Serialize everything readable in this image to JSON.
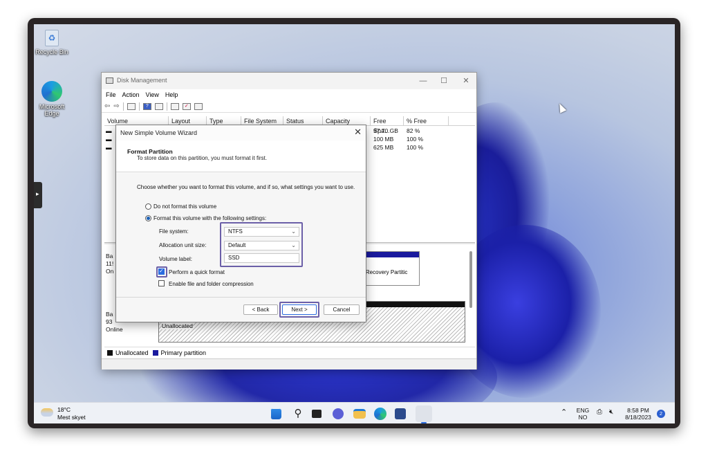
{
  "desktop": {
    "icons": [
      {
        "label": "Recycle Bin",
        "icon": "recycle-bin-icon"
      },
      {
        "label": "Microsoft Edge",
        "icon": "edge-icon"
      }
    ]
  },
  "disk_management": {
    "title": "Disk Management",
    "menu": [
      "File",
      "Action",
      "View",
      "Help"
    ],
    "columns": [
      "Volume",
      "Layout",
      "Type",
      "File System",
      "Status",
      "Capacity",
      "Free Spa...",
      "% Free"
    ],
    "rows": [
      {
        "volume": "",
        "free": "97.70 GB",
        "pct": "82 %"
      },
      {
        "volume": "(",
        "free": "100 MB",
        "pct": "100 %"
      },
      {
        "volume": "(",
        "free": "625 MB",
        "pct": "100 %"
      }
    ],
    "disk0": {
      "label_lines": [
        "Ba",
        "11!",
        "On"
      ],
      "recovery_size": "B",
      "recovery_text": "y (Recovery Partitic"
    },
    "disk1": {
      "label_lines": [
        "Ba",
        "93",
        "Online"
      ],
      "unallocated": "Unallocated"
    },
    "legend": {
      "unallocated": "Unallocated",
      "primary": "Primary partition",
      "unallocated_color": "#111111",
      "primary_color": "#1a1a9e"
    }
  },
  "wizard": {
    "title": "New Simple Volume Wizard",
    "header_title": "Format Partition",
    "header_subtitle": "To store data on this partition, you must format it first.",
    "prompt": "Choose whether you want to format this volume, and if so, what settings you want to use.",
    "option_no_format": "Do not format this volume",
    "option_format": "Format this volume with the following settings:",
    "file_system_label": "File system:",
    "file_system_value": "NTFS",
    "alloc_label": "Allocation unit size:",
    "alloc_value": "Default",
    "volume_label_label": "Volume label:",
    "volume_label_value": "SSD",
    "quick_format": "Perform a quick format",
    "compression": "Enable file and folder compression",
    "back": "< Back",
    "next": "Next >",
    "cancel": "Cancel"
  },
  "taskbar": {
    "weather_temp": "18°C",
    "weather_desc": "Mest skyet",
    "lang_top": "ENG",
    "lang_bottom": "NO",
    "time": "8:58 PM",
    "date": "8/18/2023",
    "notification_count": "2"
  },
  "colors": {
    "accent": "#2b6ce0",
    "highlight": "#6b5fa8",
    "partition": "#1a1a9e"
  }
}
